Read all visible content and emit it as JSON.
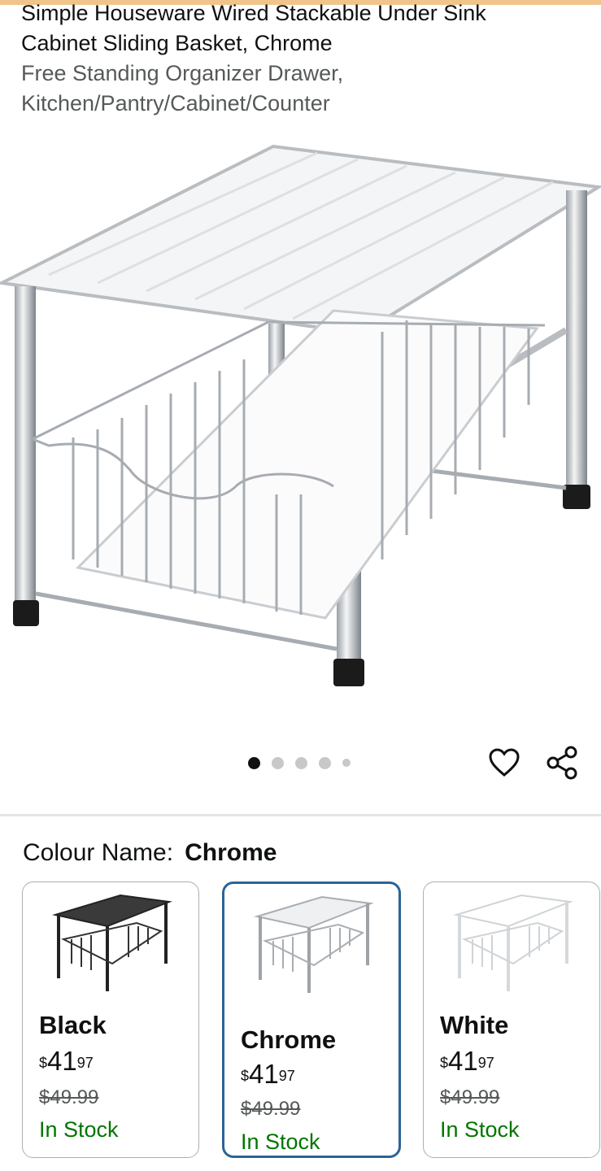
{
  "product": {
    "title_line_1": "Simple Houseware Wired Stackable Under Sink",
    "title_line_2": "Cabinet Sliding Basket, Chrome",
    "subtitle_line_1": "Free Standing Organizer Drawer,",
    "subtitle_line_2": "Kitchen/Pantry/Cabinet/Counter"
  },
  "gallery": {
    "image_count": 5,
    "active_index": 0,
    "actions": {
      "wishlist_icon": "heart-icon",
      "share_icon": "share-icon"
    }
  },
  "colour": {
    "label": "Colour Name:",
    "selected": "Chrome",
    "options": [
      {
        "name": "Black",
        "currency": "$",
        "price_whole": "41",
        "price_fraction": "97",
        "was_price": "$49.99",
        "stock": "In Stock"
      },
      {
        "name": "Chrome",
        "currency": "$",
        "price_whole": "41",
        "price_fraction": "97",
        "was_price": "$49.99",
        "stock": "In Stock"
      },
      {
        "name": "White",
        "currency": "$",
        "price_whole": "41",
        "price_fraction": "97",
        "was_price": "$49.99",
        "stock": "In Stock"
      }
    ]
  },
  "colors": {
    "accent_bar": "#f0c48a",
    "selected_border": "#2a6496",
    "in_stock": "#007600"
  }
}
